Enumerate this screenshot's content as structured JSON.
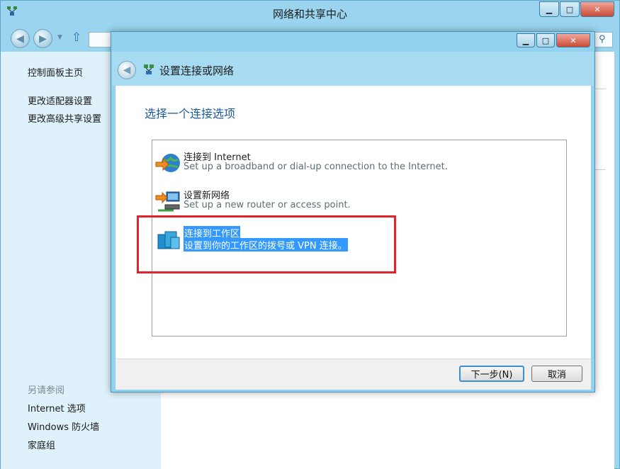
{
  "outer_window": {
    "title": "网络和共享中心",
    "buttons": {
      "minimize": "▁",
      "maximize": "□",
      "close": "✕"
    }
  },
  "sidebar": {
    "home_link": "控制面板主页",
    "links": [
      "更改适配器设置",
      "更改高级共享设置"
    ],
    "see_also_title": "另请参阅",
    "see_also": [
      "Internet 选项",
      "Windows 防火墙",
      "家庭组"
    ]
  },
  "dialog": {
    "title": "设置连接或网络",
    "heading": "选择一个连接选项",
    "options": [
      {
        "title": "连接到 Internet",
        "desc": "Set up a broadband or dial-up connection to the Internet.",
        "icon": "globe-connect-icon"
      },
      {
        "title": "设置新网络",
        "desc": "Set up a new router or access point.",
        "icon": "router-setup-icon"
      },
      {
        "title": "连接到工作区",
        "desc": "设置到你的工作区的拨号或 VPN 连接。",
        "icon": "workplace-icon",
        "selected": true
      }
    ],
    "next_button": "下一步(N)",
    "cancel_button": "取消",
    "buttons": {
      "minimize": "▁",
      "maximize": "□",
      "close": "✕"
    }
  },
  "colors": {
    "selection": "#3399ff",
    "highlight_box": "#e3232a",
    "heading": "#1c5a99"
  }
}
